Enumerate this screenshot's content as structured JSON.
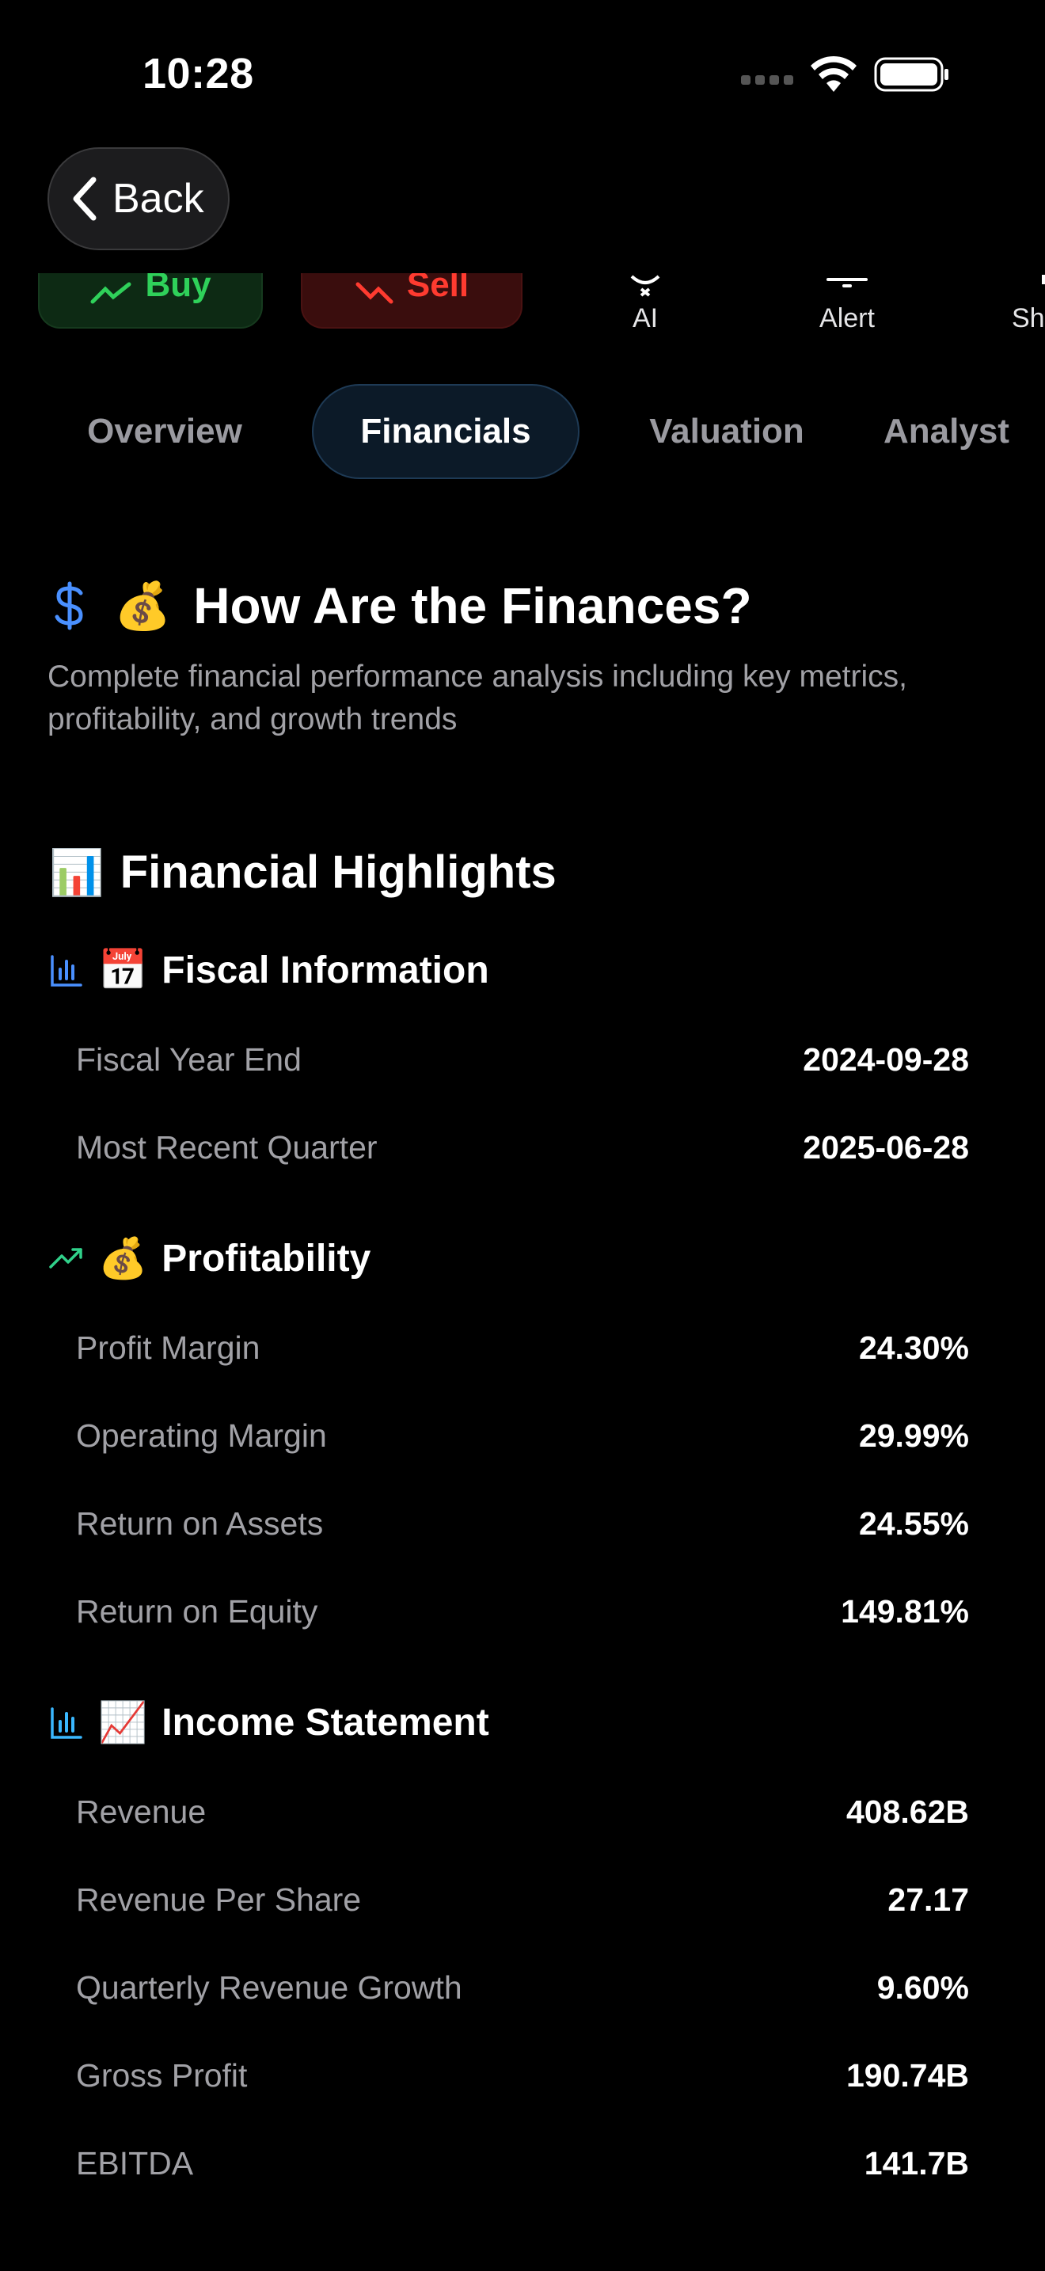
{
  "status_bar": {
    "time": "10:28"
  },
  "nav": {
    "back_label": "Back"
  },
  "actions": {
    "buy": "Buy",
    "sell": "Sell",
    "ai": "AI",
    "alert": "Alert",
    "share": "Sh"
  },
  "tabs": [
    {
      "label": "Overview"
    },
    {
      "label": "Financials"
    },
    {
      "label": "Valuation"
    },
    {
      "label": "Analyst"
    }
  ],
  "page": {
    "title": "How Are the Finances?",
    "title_emoji": "💰",
    "subtitle": "Complete financial performance analysis including key metrics, profitability, and growth trends"
  },
  "highlights": {
    "title": "Financial Highlights",
    "title_emoji": "📊",
    "groups": [
      {
        "title": "Fiscal Information",
        "emoji": "📅",
        "icon": "bar-chart-icon",
        "rows": [
          {
            "label": "Fiscal Year End",
            "value": "2024-09-28"
          },
          {
            "label": "Most Recent Quarter",
            "value": "2025-06-28"
          }
        ]
      },
      {
        "title": "Profitability",
        "emoji": "💰",
        "icon": "trending-up-icon",
        "rows": [
          {
            "label": "Profit Margin",
            "value": "24.30%"
          },
          {
            "label": "Operating Margin",
            "value": "29.99%"
          },
          {
            "label": "Return on Assets",
            "value": "24.55%"
          },
          {
            "label": "Return on Equity",
            "value": "149.81%"
          }
        ]
      },
      {
        "title": "Income Statement",
        "emoji": "📈",
        "icon": "bar-chart-icon",
        "rows": [
          {
            "label": "Revenue",
            "value": "408.62B"
          },
          {
            "label": "Revenue Per Share",
            "value": "27.17"
          },
          {
            "label": "Quarterly Revenue Growth",
            "value": "9.60%"
          },
          {
            "label": "Gross Profit",
            "value": "190.74B"
          },
          {
            "label": "EBITDA",
            "value": "141.7B"
          }
        ]
      }
    ]
  },
  "colors": {
    "accent_blue": "#4a90ff",
    "buy_green": "#2fd15a",
    "sell_red": "#ff3b30",
    "trend_green": "#30d18a",
    "bar_cyan": "#3ab8ff"
  }
}
